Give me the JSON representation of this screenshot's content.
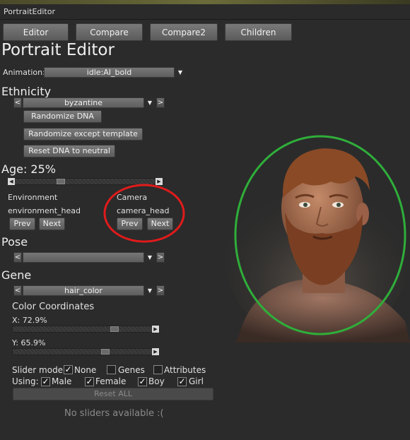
{
  "window": {
    "title": "PortraitEditor"
  },
  "tabs": [
    {
      "label": "Editor"
    },
    {
      "label": "Compare"
    },
    {
      "label": "Compare2"
    },
    {
      "label": "Children"
    }
  ],
  "page_title": "Portrait Editor",
  "animation": {
    "label": "Animation:",
    "value": "idle:AI_bold"
  },
  "ethnicity": {
    "heading": "Ethnicity",
    "value": "byzantine"
  },
  "buttons": {
    "randomize_dna": "Randomize DNA",
    "randomize_except": "Randomize except template",
    "reset_dna": "Reset DNA to neutral",
    "reset_all": "Reset ALL"
  },
  "age": {
    "label": "Age: 25%",
    "value": 0.25
  },
  "environment": {
    "heading": "Environment",
    "value": "environment_head",
    "prev": "Prev",
    "next": "Next"
  },
  "camera": {
    "heading": "Camera",
    "value": "camera_head",
    "prev": "Prev",
    "next": "Next"
  },
  "pose": {
    "heading": "Pose",
    "value": ""
  },
  "gene": {
    "heading": "Gene",
    "value": "hair_color"
  },
  "color_coords": {
    "heading": "Color Coordinates",
    "x_label": "X: 72.9%",
    "x_value": 0.729,
    "y_label": "Y: 65.9%",
    "y_value": 0.659
  },
  "slider_mode": {
    "label": "Slider mode:",
    "options": [
      {
        "label": "None",
        "checked": true
      },
      {
        "label": "Genes",
        "checked": false
      },
      {
        "label": "Attributes",
        "checked": false
      }
    ]
  },
  "using": {
    "label": "Using:",
    "options": [
      {
        "label": "Male",
        "checked": true
      },
      {
        "label": "Female",
        "checked": true
      },
      {
        "label": "Boy",
        "checked": true
      },
      {
        "label": "Girl",
        "checked": true
      }
    ]
  },
  "empty_message": "No sliders available :(",
  "colors": {
    "highlight_red": "#e01b1b",
    "highlight_green": "#2fae3a",
    "background": "#2b2b2b"
  },
  "icons": {
    "left": "chevron-left-icon",
    "right": "chevron-right-icon",
    "dropdown": "chevron-down-icon",
    "check": "checkmark-icon"
  }
}
